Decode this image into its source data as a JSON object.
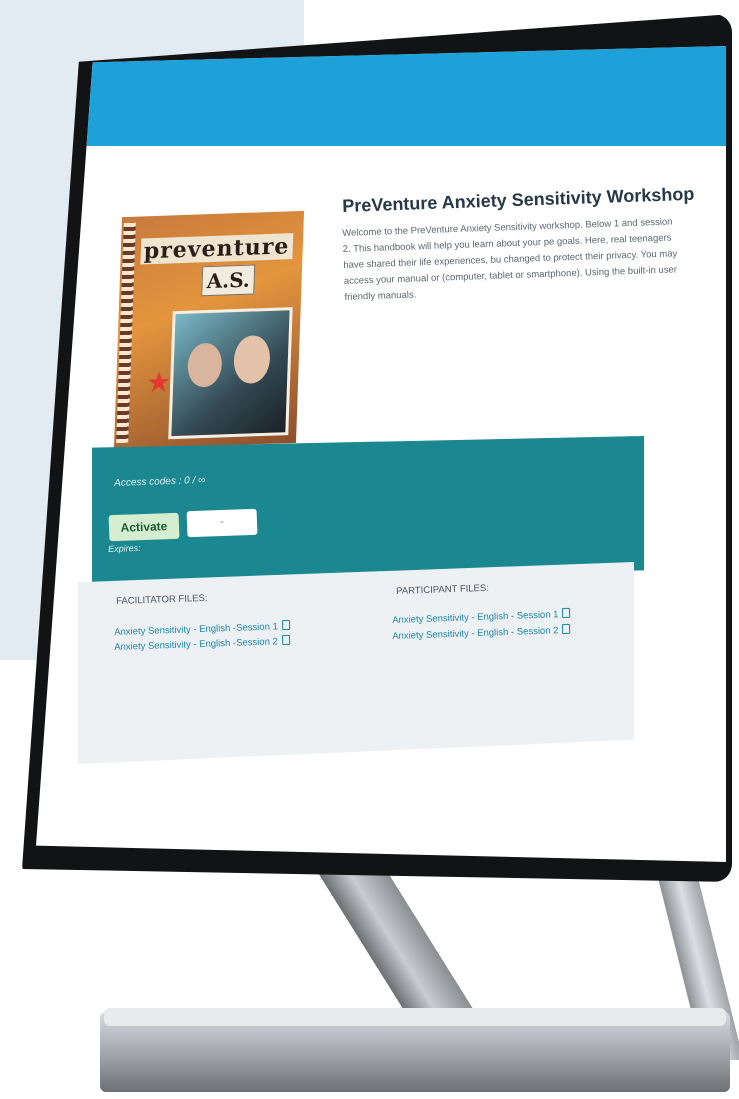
{
  "product": {
    "title": "PreVenture Anxiety Sensitivity Workshop",
    "description": "Welcome to the PreVenture Anxiety Sensitivity workshop. Below 1 and session 2. This handbook will help you learn about your pe goals. Here, real teenagers have shared their life experiences, bu changed to protect their privacy. You may access your manual or (computer, tablet or smartphone). Using the built-in user friendly manuals.",
    "cover": {
      "brand": "preventure",
      "badge": "A.S."
    }
  },
  "activation": {
    "access_codes": "Access codes : 0 / ∞",
    "activate_label": "Activate",
    "date_value": "-",
    "expires_label": "Expires:"
  },
  "facilitator": {
    "heading": "FACILITATOR FILES:",
    "files": [
      "Anxiety Sensitivity - English -Session 1",
      "Anxiety Sensitivity - English -Session 2"
    ]
  },
  "participant": {
    "heading": "PARTICIPANT FILES:",
    "files": [
      "Anxiety Sensitivity - English - Session 1",
      "Anxiety Sensitivity - English - Session 2"
    ]
  },
  "colors": {
    "header_blue": "#1da1d8",
    "teal_band": "#1b8791",
    "link": "#1a86a8",
    "activate_bg": "#d5eecf"
  },
  "icons": [
    "document-icon"
  ]
}
